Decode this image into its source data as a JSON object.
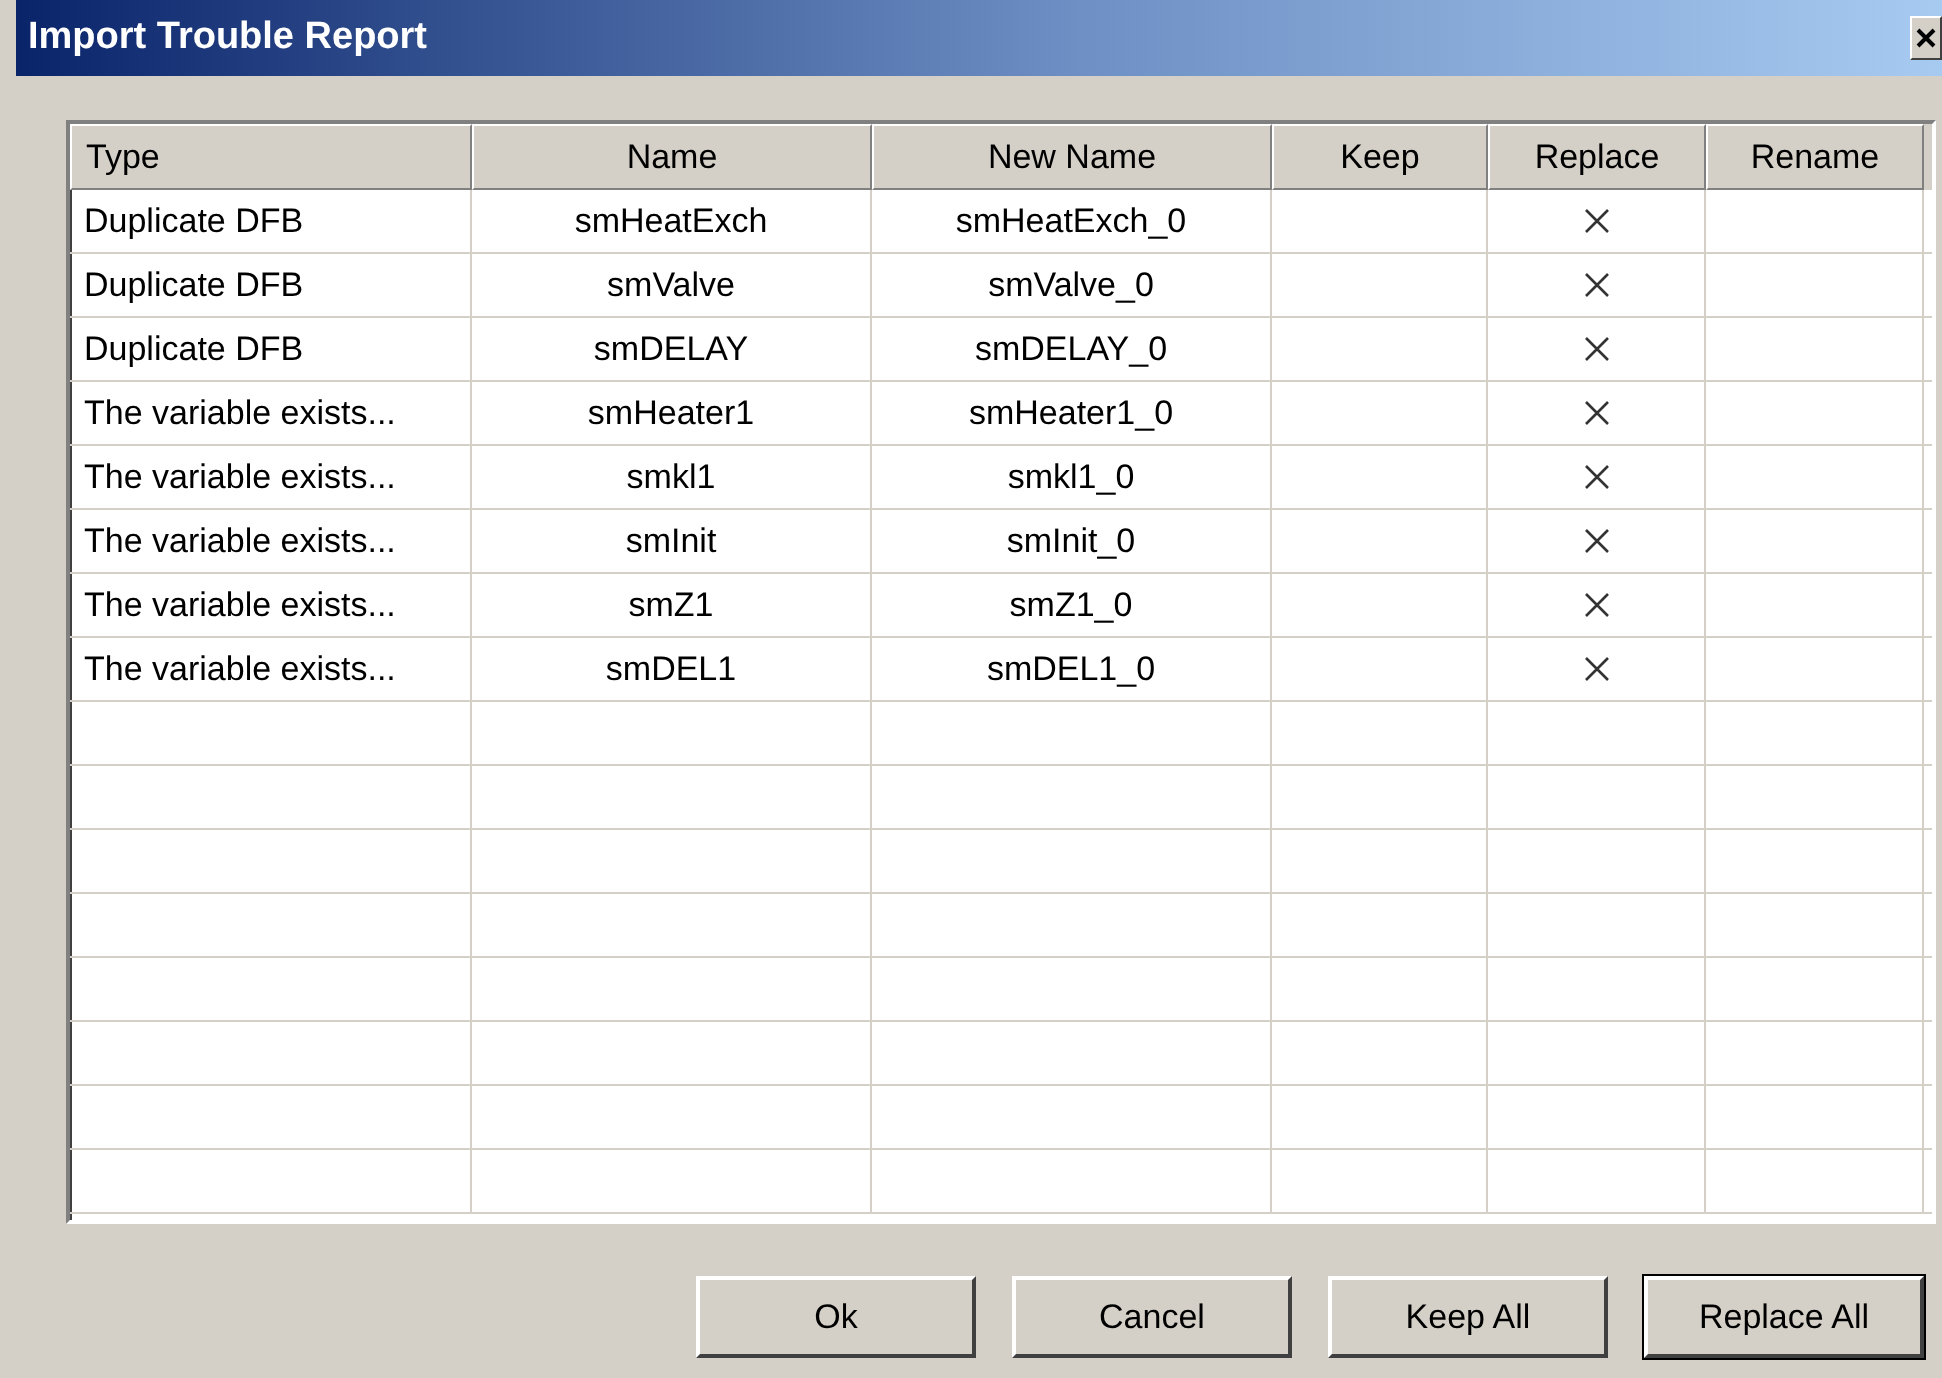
{
  "window": {
    "title": "Import Trouble Report"
  },
  "table": {
    "columns": [
      "Type",
      "Name",
      "New Name",
      "Keep",
      "Replace",
      "Rename"
    ],
    "rows": [
      {
        "type": "Duplicate DFB",
        "name": "smHeatExch",
        "new_name": "smHeatExch_0",
        "keep": false,
        "replace": true,
        "rename": false
      },
      {
        "type": "Duplicate DFB",
        "name": "smValve",
        "new_name": "smValve_0",
        "keep": false,
        "replace": true,
        "rename": false
      },
      {
        "type": "Duplicate DFB",
        "name": "smDELAY",
        "new_name": "smDELAY_0",
        "keep": false,
        "replace": true,
        "rename": false
      },
      {
        "type": "The variable exists...",
        "name": "smHeater1",
        "new_name": "smHeater1_0",
        "keep": false,
        "replace": true,
        "rename": false
      },
      {
        "type": "The variable exists...",
        "name": "smkl1",
        "new_name": "smkl1_0",
        "keep": false,
        "replace": true,
        "rename": false
      },
      {
        "type": "The variable exists...",
        "name": "smInit",
        "new_name": "smInit_0",
        "keep": false,
        "replace": true,
        "rename": false
      },
      {
        "type": "The variable exists...",
        "name": "smZ1",
        "new_name": "smZ1_0",
        "keep": false,
        "replace": true,
        "rename": false
      },
      {
        "type": "The variable exists...",
        "name": "smDEL1",
        "new_name": "smDEL1_0",
        "keep": false,
        "replace": true,
        "rename": false
      }
    ]
  },
  "buttons": [
    {
      "label": "Ok",
      "default": false
    },
    {
      "label": "Cancel",
      "default": false
    },
    {
      "label": "Keep All",
      "default": false
    },
    {
      "label": "Replace All",
      "default": true
    }
  ]
}
